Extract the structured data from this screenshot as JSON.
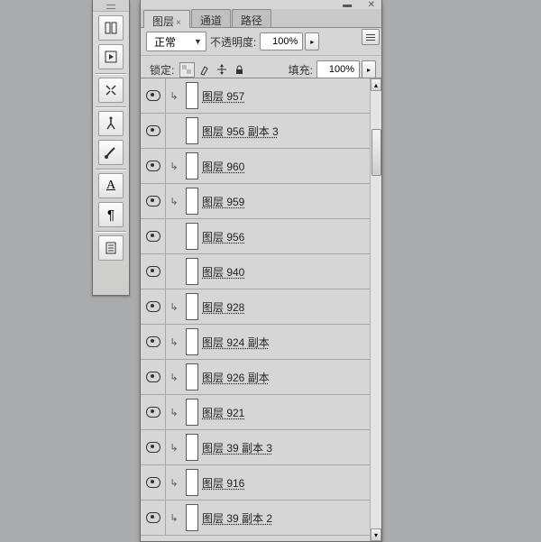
{
  "tabs": [
    "图层",
    "通道",
    "路径"
  ],
  "blend": {
    "mode": "正常",
    "opacity_label": "不透明度:",
    "opacity": "100%"
  },
  "lock": {
    "label": "锁定:",
    "fill_label": "填充:",
    "fill": "100%"
  },
  "layers": [
    {
      "name": "图层 957",
      "clip": true
    },
    {
      "name": "图层 956 副本 3",
      "clip": false
    },
    {
      "name": "图层 960",
      "clip": true
    },
    {
      "name": "图层 959",
      "clip": true
    },
    {
      "name": "图层 956",
      "clip": false
    },
    {
      "name": "图层 940",
      "clip": false
    },
    {
      "name": "图层 928",
      "clip": true
    },
    {
      "name": "图层 924 副本",
      "clip": true
    },
    {
      "name": "图层 926 副本",
      "clip": true
    },
    {
      "name": "图层 921",
      "clip": true
    },
    {
      "name": "图层 39 副本 3",
      "clip": true
    },
    {
      "name": "图层 916",
      "clip": true
    },
    {
      "name": "图层 39 副本 2",
      "clip": true
    }
  ]
}
